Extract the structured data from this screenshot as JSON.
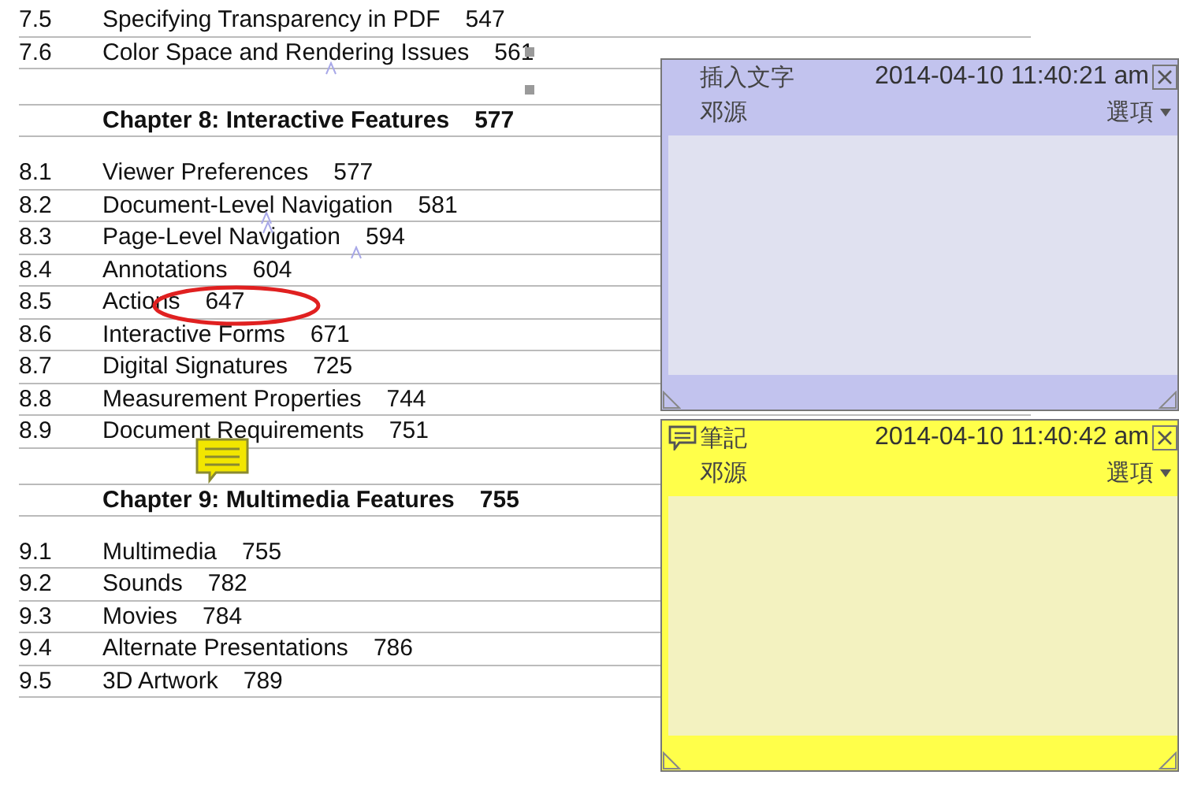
{
  "toc": {
    "entries": [
      {
        "kind": "section",
        "number": "7.5",
        "title": "Specifying Transparency in PDF",
        "page": "547"
      },
      {
        "kind": "section",
        "number": "7.6",
        "title": "Color Space and Rendering Issues",
        "page": "561"
      },
      {
        "kind": "chapter",
        "title": "Chapter  8:  Interactive Features",
        "page": "577"
      },
      {
        "kind": "section",
        "number": "8.1",
        "title": "Viewer Preferences",
        "page": "577"
      },
      {
        "kind": "section",
        "number": "8.2",
        "title": "Document-Level Navigation",
        "page": "581"
      },
      {
        "kind": "section",
        "number": "8.3",
        "title": "Page-Level Navigation",
        "page": "594"
      },
      {
        "kind": "section",
        "number": "8.4",
        "title": "Annotations",
        "page": "604"
      },
      {
        "kind": "section",
        "number": "8.5",
        "title": "Actions",
        "page": "647"
      },
      {
        "kind": "section",
        "number": "8.6",
        "title": "Interactive Forms",
        "page": "671"
      },
      {
        "kind": "section",
        "number": "8.7",
        "title": "Digital Signatures",
        "page": "725"
      },
      {
        "kind": "section",
        "number": "8.8",
        "title": "Measurement Properties",
        "page": "744"
      },
      {
        "kind": "section",
        "number": "8.9",
        "title": "Document Requirements",
        "page": "751"
      },
      {
        "kind": "chapter",
        "title": "Chapter  9:  Multimedia Features",
        "page": "755"
      },
      {
        "kind": "section",
        "number": "9.1",
        "title": "Multimedia",
        "page": "755"
      },
      {
        "kind": "section",
        "number": "9.2",
        "title": "Sounds",
        "page": "782"
      },
      {
        "kind": "section",
        "number": "9.3",
        "title": "Movies",
        "page": "784"
      },
      {
        "kind": "section",
        "number": "9.4",
        "title": "Alternate Presentations",
        "page": "786"
      },
      {
        "kind": "section",
        "number": "9.5",
        "title": "3D Artwork",
        "page": "789"
      }
    ]
  },
  "popups": [
    {
      "kind": "insert",
      "title": "插入文字",
      "date": "2014-04-10 11:40:21 am",
      "author": "邓源",
      "options": "選項"
    },
    {
      "kind": "note",
      "title": "筆記",
      "date": "2014-04-10 11:40:42 am",
      "author": "邓源",
      "options": "選項"
    }
  ]
}
